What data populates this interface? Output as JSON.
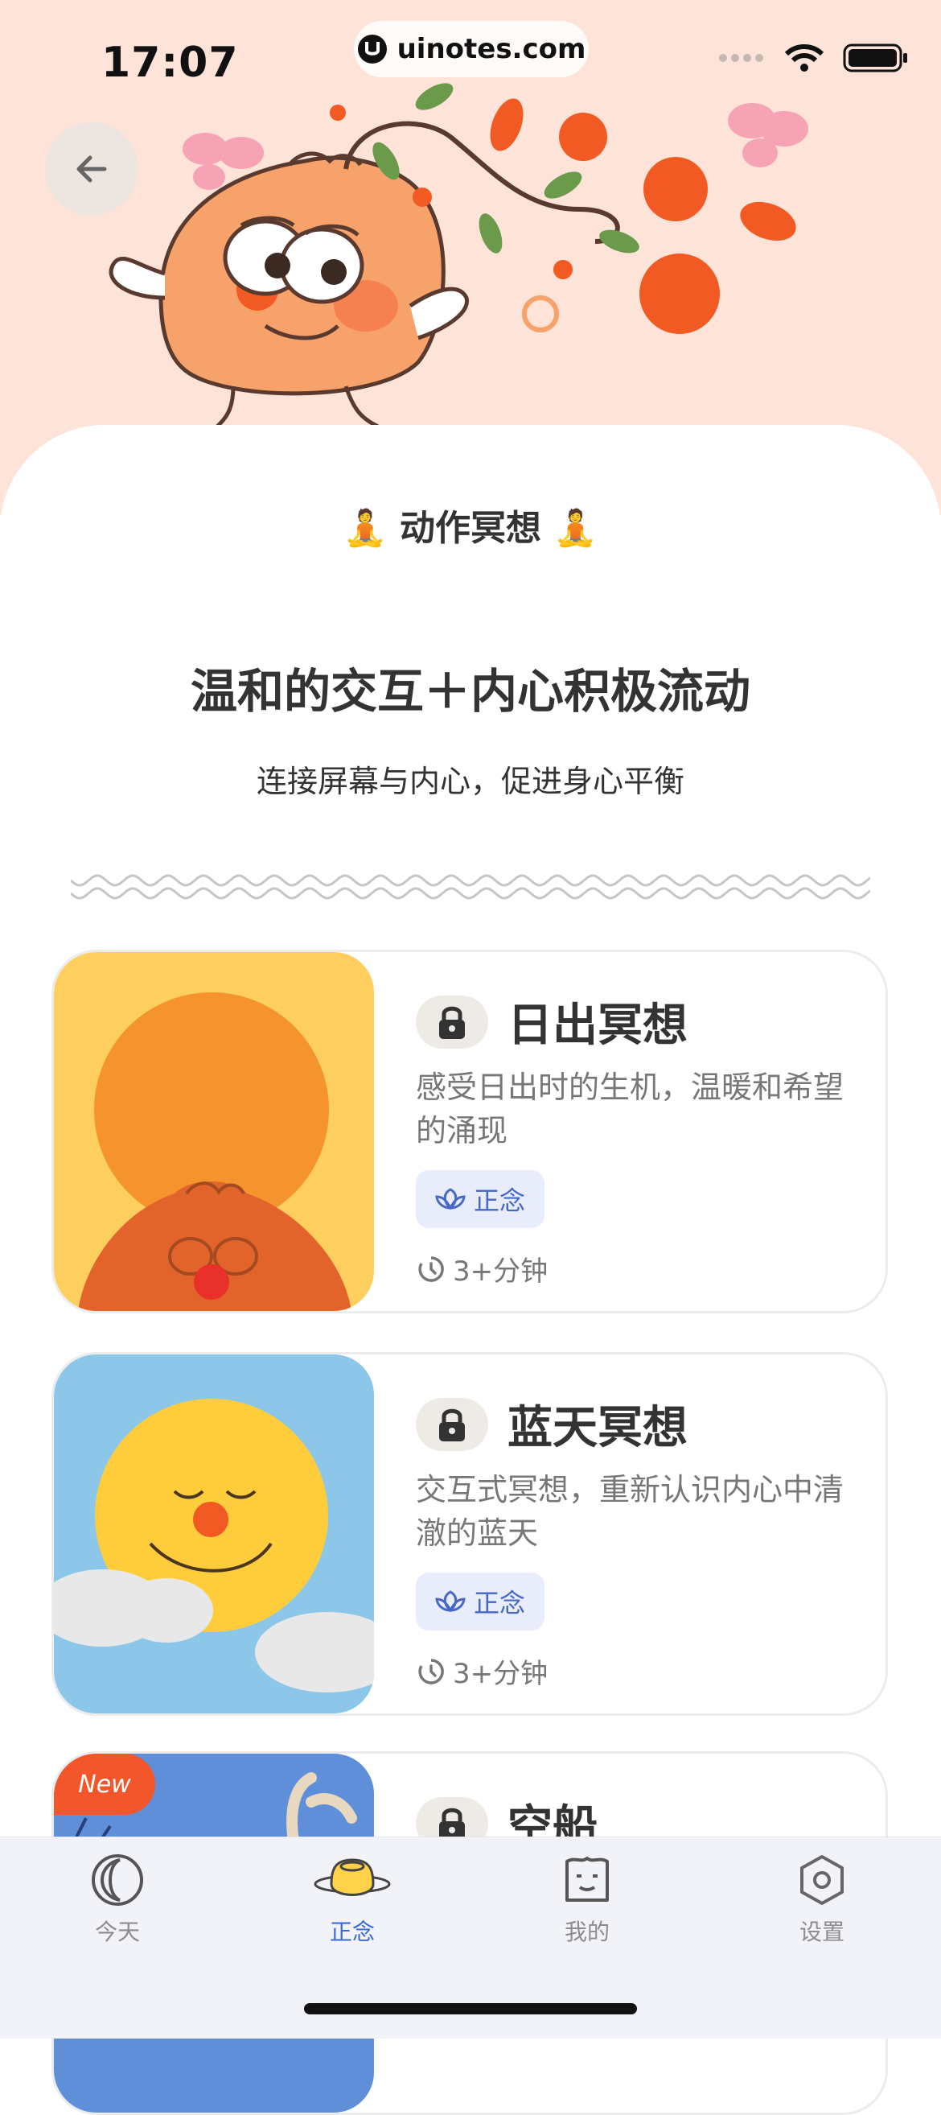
{
  "status_bar": {
    "time": "17:07",
    "url": "uinotes.com"
  },
  "header": {
    "back_icon": "arrow-left-icon"
  },
  "section": {
    "title": "🧘 动作冥想 🧘"
  },
  "intro": {
    "headline": "温和的交互＋内心积极流动",
    "subheadline": "连接屏幕与内心，促进身心平衡"
  },
  "cards": [
    {
      "title": "日出冥想",
      "description": "感受日出时的生机，温暖和希望的涌现",
      "tag": "正念",
      "duration": "3+分钟",
      "locked": true
    },
    {
      "title": "蓝天冥想",
      "description": "交互式冥想，重新认识内心中清澈的蓝天",
      "tag": "正念",
      "duration": "3+分钟",
      "locked": true
    },
    {
      "title": "空船",
      "badge": "New",
      "locked": true
    }
  ],
  "tabbar": {
    "items": [
      {
        "label": "今天",
        "icon": "moon-circle-icon",
        "active": false
      },
      {
        "label": "正念",
        "icon": "bun-icon",
        "active": true
      },
      {
        "label": "我的",
        "icon": "face-square-icon",
        "active": false
      },
      {
        "label": "设置",
        "icon": "gear-icon",
        "active": false
      }
    ],
    "active_color": "#3a6ad8"
  },
  "colors": {
    "hero_bg": "#fde3d8",
    "accent_orange": "#f2562a",
    "tag_bg": "#e9edfb",
    "tag_text": "#4668c7"
  }
}
